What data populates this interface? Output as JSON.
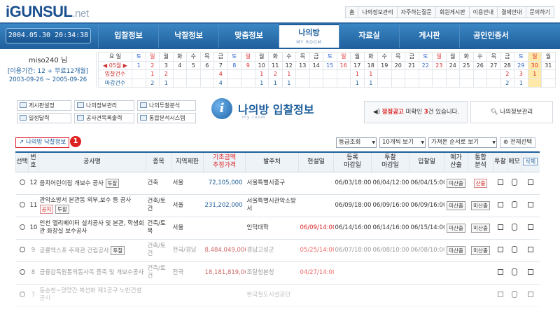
{
  "logo": {
    "main": "iGUNSUL",
    "suffix": ".net"
  },
  "top_links": [
    "홈",
    "나의정보관리",
    "자주하는질문",
    "회원게시판",
    "이용안내",
    "결제안내",
    "문의하기"
  ],
  "clock": "2004.05.30 20:34:38",
  "nav": [
    {
      "label": "입찰정보"
    },
    {
      "label": "낙찰정보"
    },
    {
      "label": "맞춤정보"
    },
    {
      "label": "나의방",
      "sub": "MY ROOM",
      "active": true
    },
    {
      "label": "자료실"
    },
    {
      "label": "게시판"
    },
    {
      "label": "공인인증서"
    }
  ],
  "user": {
    "name": "miso240 님",
    "period": "[이용기간: 12 + 무료12개월]",
    "range": "2003-09-26 ~ 2005-09-26"
  },
  "calendar": {
    "weekday_label": "요 일",
    "month_label": "◀ 05월 ▶",
    "bid_label": "입찰건수",
    "close_label": "마감건수",
    "weekdays": [
      "토",
      "일",
      "월",
      "화",
      "수",
      "목",
      "금",
      "토",
      "일",
      "월",
      "화",
      "수",
      "목",
      "금",
      "토",
      "일",
      "월",
      "화",
      "수",
      "목",
      "금",
      "토",
      "일",
      "월",
      "화",
      "수",
      "목",
      "금",
      "토",
      "일",
      "월"
    ],
    "days": [
      "1",
      "2",
      "3",
      "4",
      "5",
      "6",
      "7",
      "8",
      "9",
      "10",
      "11",
      "12",
      "13",
      "14",
      "15",
      "16",
      "17",
      "18",
      "19",
      "20",
      "21",
      "22",
      "23",
      "24",
      "25",
      "26",
      "27",
      "28",
      "29",
      "30",
      "31"
    ],
    "bid_counts": [
      "",
      "1",
      "2",
      "",
      "",
      "",
      "4",
      "",
      "",
      "1",
      "2",
      "1",
      "",
      "",
      "",
      "",
      "1",
      "1",
      "",
      "",
      "",
      "",
      "",
      "",
      "",
      "",
      "",
      "2",
      "3",
      "1",
      ""
    ],
    "close_counts": [
      "",
      "2",
      "1",
      "",
      "",
      "",
      "4",
      "",
      "",
      "1",
      "1",
      "1",
      "",
      "",
      "",
      "",
      "1",
      "1",
      "",
      "",
      "",
      "",
      "",
      "",
      "",
      "",
      "",
      "2",
      "1",
      "",
      ""
    ],
    "today": "30"
  },
  "tools": [
    "게시판설정",
    "나의정보관리",
    "나의투찰분석",
    "일정달력",
    "공사견목록출력",
    "통합분석시스템"
  ],
  "page_title": {
    "title": "나의방 입찰정보",
    "sub": "my room"
  },
  "notice": {
    "prefix": "정정공고",
    "mid": " 미확인 ",
    "count": "3",
    "suffix": "건 있습니다."
  },
  "my_info_button": "나의정보관리",
  "my_bid_link": "나의방 낙찰정보",
  "callout": "1",
  "controls": {
    "sort_view": "등급조회",
    "page_size": "10개씩 보기",
    "order": "가져온 순서로 보기",
    "select_all": "전체선택"
  },
  "table": {
    "headers": [
      "선택",
      "번호",
      "공사명",
      "종목",
      "지역제한",
      "기초금액\n추정가격",
      "발주처",
      "현설일",
      "등록\n마감일",
      "투찰\n마감일",
      "입찰일",
      "예가\n산출",
      "통합\n분석",
      "투찰",
      "메모",
      "삭제"
    ],
    "rows": [
      {
        "no": "12",
        "name": "음지어린이집 개보수 공사",
        "tag": "투찰",
        "kind": "건축",
        "region": "서울",
        "amount": "72,105,000",
        "client": "서울특별시중구",
        "site": "",
        "reg": "06/03/18:00",
        "close": "06/04/12:00",
        "bid": "06/04/15:00",
        "est": "미산출",
        "ana": "산출",
        "ana_red": true,
        "past": false
      },
      {
        "no": "11",
        "name": "관악소방서 본관동 외부,보수 등 공사",
        "tag": "투찰",
        "tag2": "공지",
        "kind": "건축/토건",
        "region": "서울",
        "amount": "231,202,000",
        "client": "서울특별시관악소방서",
        "site": "",
        "reg": "06/09/18:00",
        "close": "06/09/16:00",
        "bid": "06/09/16:00",
        "est": "미산출",
        "ana": "미산출",
        "ana_red": false,
        "past": false
      },
      {
        "no": "10",
        "name": "인천 엘리베이터 설치공사 및 본관, 학생회관 화장실 보수공사",
        "tag": "",
        "kind": "건축/토목",
        "region": "서울",
        "amount": "",
        "client": "인덕대학",
        "site": "06/09/14:00",
        "reg": "06/14/16:00",
        "close": "06/14/16:00",
        "bid": "06/15/14:00",
        "est": "미산출",
        "ana": "미산출",
        "ana_red": false,
        "past": false
      },
      {
        "no": "9",
        "name": "공룡엑스포 주제관 건립공사",
        "tag": "투찰",
        "kind": "건축/토건",
        "region": "전국/경남",
        "amount": "8,484,049,000",
        "client": "경남고성군",
        "site": "05/25/14:00",
        "reg": "06/07/18:00",
        "close": "06/08/10:00",
        "bid": "06/08/10:00",
        "est": "미산출",
        "ana": "미산출",
        "ana_red": false,
        "past": true
      },
      {
        "no": "8",
        "name": "금융감독원통의동사옥 증축 및 개보수공사",
        "tag": "",
        "kind": "건축/토건",
        "region": "전국",
        "amount": "18,181,819,000",
        "client": "조달청본청",
        "site": "04/27/14:00",
        "reg": "",
        "close": "",
        "bid": "",
        "est": "",
        "ana": "",
        "ana_red": false,
        "past": true
      },
      {
        "no": "7",
        "name": "동순천~광양간 복선화 제1공구 노반건설공사",
        "tag": "",
        "kind": "",
        "region": "",
        "amount": "",
        "client": "한국철도시설공단",
        "site": "",
        "reg": "",
        "close": "",
        "bid": "",
        "est": "",
        "ana": "",
        "ana_red": false,
        "past": true
      }
    ]
  },
  "colors": {
    "brand": "#1f5f9c",
    "accent": "#d22222"
  }
}
